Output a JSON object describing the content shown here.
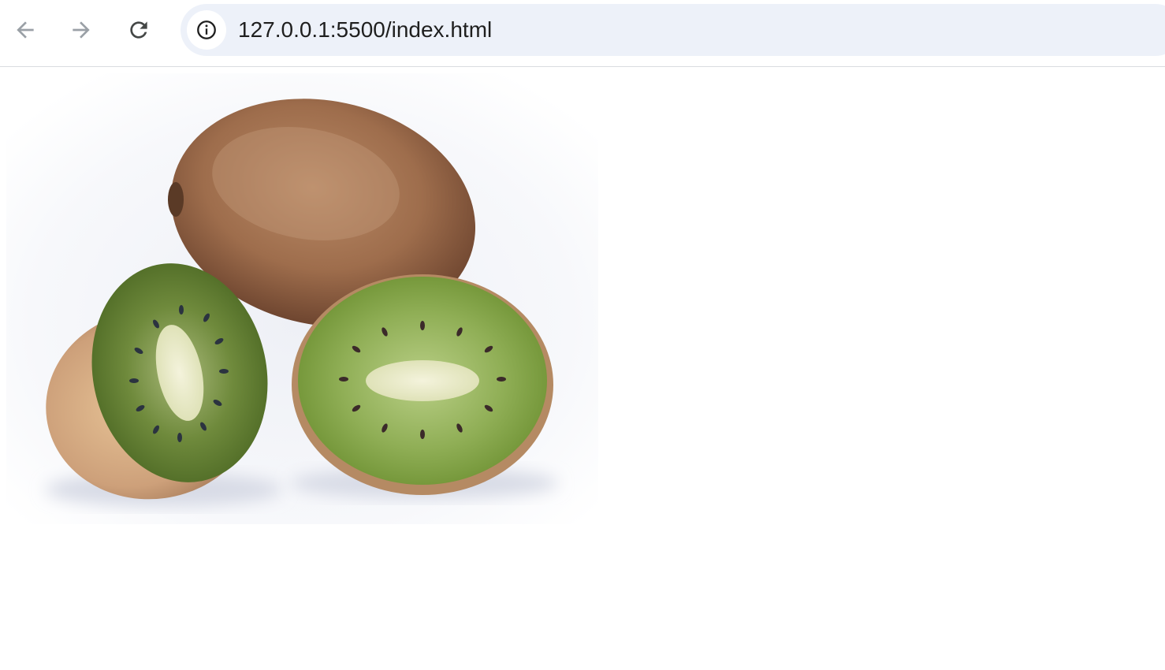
{
  "browser": {
    "address_bar": {
      "url": "127.0.0.1:5500/index.html"
    },
    "icons": {
      "back": "arrow-left-icon",
      "forward": "arrow-right-icon",
      "reload": "reload-icon",
      "site_info": "info-icon"
    },
    "colors": {
      "omnibox_bg": "#edf1f9",
      "nav_disabled": "#9aa0a6",
      "nav_active": "#444746"
    }
  },
  "page": {
    "content": {
      "image_subject": "kiwi-fruit-image"
    }
  }
}
